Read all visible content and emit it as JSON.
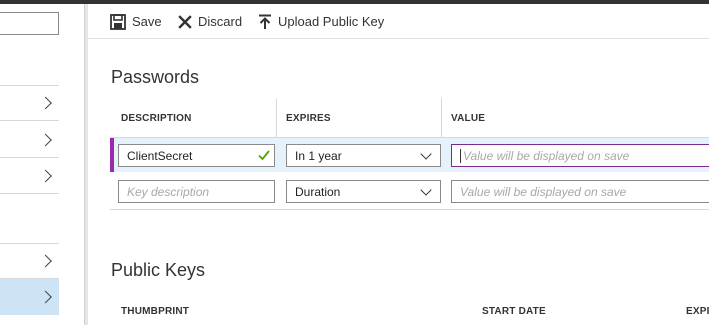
{
  "toolbar": {
    "save_label": "Save",
    "discard_label": "Discard",
    "upload_label": "Upload Public Key"
  },
  "passwords": {
    "title": "Passwords",
    "columns": [
      "DESCRIPTION",
      "EXPIRES",
      "VALUE"
    ],
    "rows": [
      {
        "description": "ClientSecret",
        "expires": "In 1 year",
        "value_placeholder": "Value will be displayed on save",
        "valid": true
      },
      {
        "description_placeholder": "Key description",
        "expires": "Duration",
        "value_placeholder": "Value will be displayed on save"
      }
    ]
  },
  "public_keys": {
    "title": "Public Keys",
    "columns": [
      "THUMBPRINT",
      "START DATE",
      "EXPI"
    ]
  },
  "colors": {
    "accent": "#9c27b0",
    "selected_row": "#e6f2fb",
    "nav_selected": "#cce4f6",
    "valid_check": "#57a300"
  }
}
